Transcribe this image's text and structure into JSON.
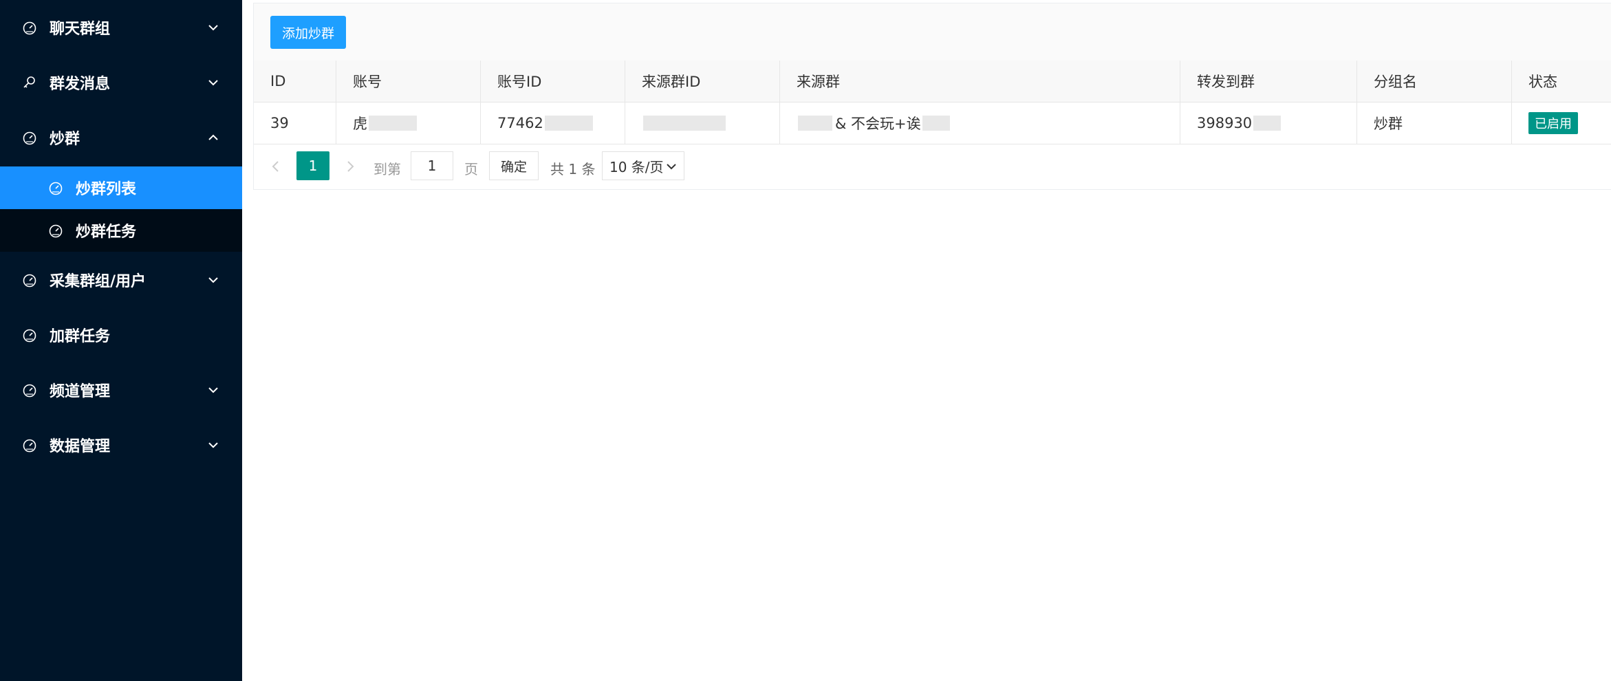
{
  "sidebar": {
    "items": [
      {
        "label": "聊天群组",
        "icon": "dashboard-icon",
        "expandable": true,
        "expanded": false
      },
      {
        "label": "群发消息",
        "icon": "key-icon",
        "expandable": true,
        "expanded": false
      },
      {
        "label": "炒群",
        "icon": "dashboard-icon",
        "expandable": true,
        "expanded": true
      },
      {
        "label": "采集群组/用户",
        "icon": "dashboard-icon",
        "expandable": true,
        "expanded": false
      },
      {
        "label": "加群任务",
        "icon": "dashboard-icon",
        "expandable": false,
        "expanded": false
      },
      {
        "label": "频道管理",
        "icon": "dashboard-icon",
        "expandable": true,
        "expanded": false
      },
      {
        "label": "数据管理",
        "icon": "dashboard-icon",
        "expandable": true,
        "expanded": false
      }
    ],
    "subitems": [
      {
        "label": "炒群列表",
        "icon": "dashboard-icon",
        "active": true
      },
      {
        "label": "炒群任务",
        "icon": "dashboard-icon",
        "active": false
      }
    ]
  },
  "toolbar": {
    "add_label": "添加炒群"
  },
  "table": {
    "headers": [
      "ID",
      "账号",
      "账号ID",
      "来源群ID",
      "来源群",
      "转发到群",
      "分组名",
      "状态"
    ],
    "row": {
      "id": "39",
      "account": "虎",
      "account_id": "77462",
      "source_group_id": "",
      "source_group": "& 不会玩+诶",
      "forward_to": "398930",
      "group_name": "炒群",
      "status": "已启用"
    }
  },
  "pagination": {
    "current_page": "1",
    "goto_label": "到第",
    "page_input": "1",
    "page_unit": "页",
    "confirm_label": "确定",
    "total_text": "共 1 条",
    "page_size": "10 条/页"
  },
  "colors": {
    "sidebar_bg": "#001529",
    "submenu_bg": "#000c17",
    "active_blue": "#1890ff",
    "button_blue": "#1e9fff",
    "teal": "#009688"
  }
}
